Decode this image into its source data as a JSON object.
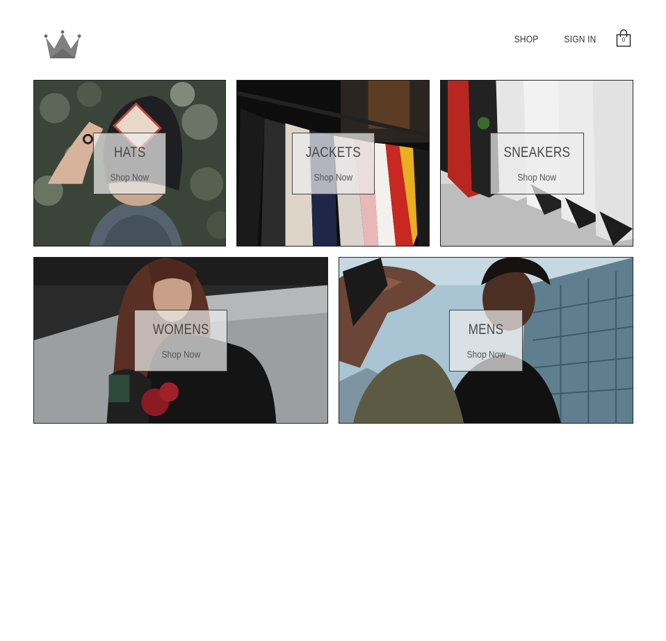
{
  "header": {
    "logo_icon": "crown-icon",
    "nav": {
      "shop_label": "SHOP",
      "signin_label": "SIGN IN"
    },
    "cart": {
      "icon": "shopping-bag-icon",
      "count": "0"
    }
  },
  "categories": [
    {
      "title": "HATS",
      "cta": "Shop Now"
    },
    {
      "title": "JACKETS",
      "cta": "Shop Now"
    },
    {
      "title": "SNEAKERS",
      "cta": "Shop Now"
    },
    {
      "title": "WOMENS",
      "cta": "Shop Now"
    },
    {
      "title": "MENS",
      "cta": "Shop Now"
    }
  ],
  "colors": {
    "background": "#ffffff",
    "text": "#333333",
    "label_box": "#ebebeb",
    "border": "#222222"
  }
}
